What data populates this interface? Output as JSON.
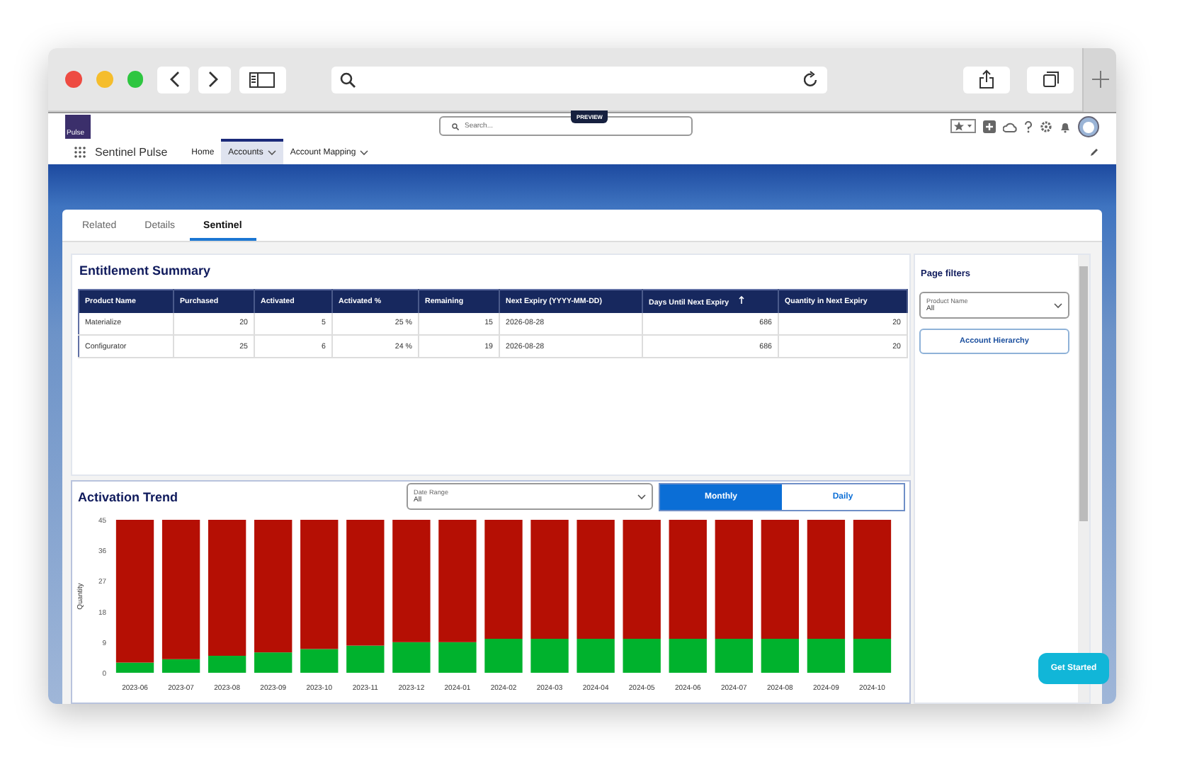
{
  "app": {
    "logo_text": "Pulse",
    "name": "Sentinel Pulse",
    "search_placeholder": "Search...",
    "preview_badge": "PREVIEW"
  },
  "nav": [
    {
      "label": "Home",
      "selected": false,
      "dropdown": false
    },
    {
      "label": "Accounts",
      "selected": true,
      "dropdown": true
    },
    {
      "label": "Account Mapping",
      "selected": false,
      "dropdown": true
    }
  ],
  "record_tabs": [
    {
      "label": "Related",
      "selected": false
    },
    {
      "label": "Details",
      "selected": false
    },
    {
      "label": "Sentinel",
      "selected": true
    }
  ],
  "entitlement_summary": {
    "title": "Entitlement Summary",
    "columns": [
      {
        "label": "Product Name",
        "kind": "text",
        "sorted": false
      },
      {
        "label": "Purchased",
        "kind": "number",
        "sorted": false
      },
      {
        "label": "Activated",
        "kind": "number",
        "sorted": false
      },
      {
        "label": "Activated %",
        "kind": "number",
        "sorted": false
      },
      {
        "label": "Remaining",
        "kind": "number",
        "sorted": false
      },
      {
        "label": "Next Expiry (YYYY-MM-DD)",
        "kind": "text",
        "sorted": false
      },
      {
        "label": "Days Until Next Expiry",
        "kind": "number",
        "sorted": true
      },
      {
        "label": "Quantity in Next Expiry",
        "kind": "number",
        "sorted": false
      }
    ],
    "rows": [
      [
        "Materialize",
        "20",
        "5",
        "25 %",
        "15",
        "2026-08-28",
        "686",
        "20"
      ],
      [
        "Configurator",
        "25",
        "6",
        "24 %",
        "19",
        "2026-08-28",
        "686",
        "20"
      ]
    ]
  },
  "activation_trend": {
    "title": "Activation Trend",
    "date_range": {
      "label": "Date Range",
      "value": "All"
    },
    "granularity": [
      {
        "label": "Monthly",
        "selected": true
      },
      {
        "label": "Daily",
        "selected": false
      }
    ],
    "chart_data": {
      "type": "bar",
      "stacked": true,
      "ylabel": "Quantity",
      "ylim": [
        0,
        45
      ],
      "yticks": [
        0,
        9,
        18,
        27,
        36,
        45
      ],
      "categories": [
        "2023-06",
        "2023-07",
        "2023-08",
        "2023-09",
        "2023-10",
        "2023-11",
        "2023-12",
        "2024-01",
        "2024-02",
        "2024-03",
        "2024-04",
        "2024-05",
        "2024-06",
        "2024-07",
        "2024-08",
        "2024-09",
        "2024-10"
      ],
      "series": [
        {
          "color": "#00b22d",
          "values": [
            3,
            4,
            5,
            6,
            7,
            8,
            9,
            9,
            10,
            10,
            10,
            10,
            10,
            10,
            10,
            10,
            10
          ]
        },
        {
          "color": "#b50f04",
          "values": [
            42,
            41,
            40,
            39,
            38,
            37,
            36,
            36,
            35,
            35,
            35,
            35,
            35,
            35,
            35,
            35,
            35
          ]
        }
      ]
    }
  },
  "page_filters": {
    "title": "Page filters",
    "product_filter": {
      "label": "Product Name",
      "value": "All"
    },
    "button": "Account Hierarchy"
  },
  "get_started": "Get Started"
}
